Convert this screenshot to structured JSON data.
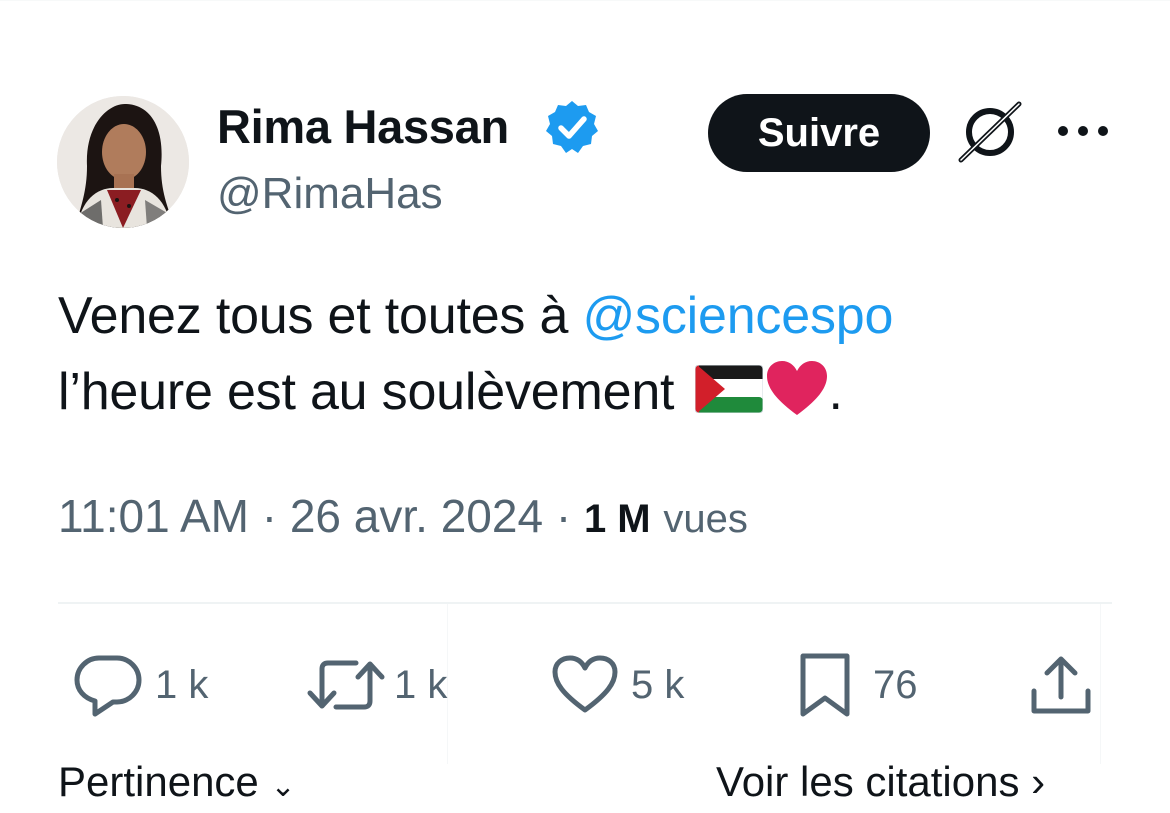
{
  "author": {
    "display_name": "Rima Hassan",
    "handle": "@RimaHas",
    "verified_icon": "verified-badge-icon",
    "avatar": "avatar"
  },
  "header": {
    "follow_label": "Suivre",
    "grok_icon": "grok-icon",
    "more_icon": "more-options-icon"
  },
  "tweet": {
    "text_part1": "Venez tous et toutes à ",
    "mention": "@sciencespo",
    "text_part2": "l’heure est au soulèvement ",
    "trailing": ".",
    "emoji_flag": "palestine-flag",
    "emoji_heart": "red-heart"
  },
  "meta": {
    "time": "11:01 AM",
    "separator": " · ",
    "date": "26 avr. 2024",
    "views_count": "1 M",
    "views_label": "vues"
  },
  "actions": {
    "reply_count": "1 k",
    "retweet_count": "1 k",
    "like_count": "5 k",
    "bookmark_count": "76"
  },
  "footer": {
    "sort_label": "Pertinence",
    "quotes_label": "Voir les citations"
  },
  "colors": {
    "text": "#0f1419",
    "secondary": "#536471",
    "accent": "#1d9bf0",
    "follow_bg": "#0f1419"
  }
}
